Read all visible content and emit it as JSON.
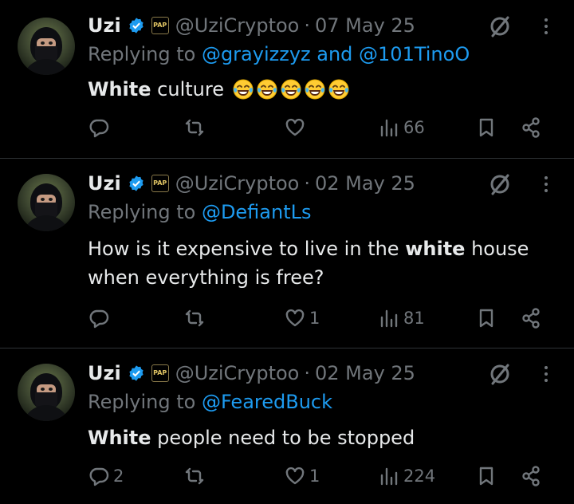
{
  "tweets": [
    {
      "name": "Uzi",
      "badge": "PAP",
      "handle": "@UziCryptoo",
      "separator": "·",
      "date": "07 May 25",
      "replying_prefix": "Replying to ",
      "replying_to": "@grayizzyz and @101TinoO",
      "text_bold": "White",
      "text_rest": " culture",
      "emoji": [
        "😂",
        "😂",
        "😂",
        "😂",
        "😂"
      ],
      "replies": "",
      "retweets": "",
      "likes": "",
      "views": "66"
    },
    {
      "name": "Uzi",
      "badge": "PAP",
      "handle": "@UziCryptoo",
      "separator": "·",
      "date": "02 May 25",
      "replying_prefix": "Replying to ",
      "replying_to": "@DefiantLs",
      "text_pre": "How is it expensive to live in the ",
      "text_bold": "white",
      "text_rest": " house when everything is free?",
      "replies": "",
      "retweets": "",
      "likes": "1",
      "views": "81"
    },
    {
      "name": "Uzi",
      "badge": "PAP",
      "handle": "@UziCryptoo",
      "separator": "·",
      "date": "02 May 25",
      "replying_prefix": "Replying to ",
      "replying_to": "@FearedBuck",
      "text_bold": "White",
      "text_rest": " people need to be stopped",
      "replies": "2",
      "retweets": "",
      "likes": "1",
      "views": "224"
    }
  ],
  "colors": {
    "background": "#000000",
    "text": "#e7e9ea",
    "muted": "#71767b",
    "link": "#1d9bf0",
    "divider": "#2f3336",
    "verified": "#1d9bf0"
  },
  "icons": [
    "verified-icon",
    "grok-icon",
    "more-icon",
    "reply-icon",
    "retweet-icon",
    "like-icon",
    "views-icon",
    "bookmark-icon",
    "share-icon"
  ]
}
